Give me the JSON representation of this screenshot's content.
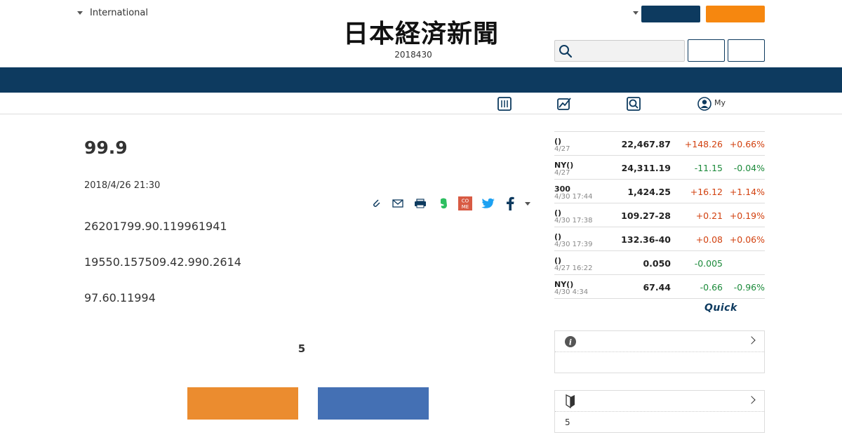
{
  "header": {
    "edition_label": "International",
    "logo_text": "日本経済新聞",
    "date_line": "2018430"
  },
  "subnav": {
    "my_label": "My"
  },
  "article": {
    "headline": "99.9",
    "pubdate": "2018/4/26 21:30",
    "paragraphs": [
      "26201799.90.119961941",
      "19550.157509.42.990.2614",
      "97.60.11994"
    ],
    "count_label": "5"
  },
  "market": {
    "rows": [
      {
        "name": "()",
        "date": "4/27",
        "value": "22,467.87",
        "change": "+148.26",
        "pct": "+0.66%",
        "dir": "up"
      },
      {
        "name": "NY()",
        "date": "4/27",
        "value": "24,311.19",
        "change": "-11.15",
        "pct": "-0.04%",
        "dir": "down"
      },
      {
        "name": "300",
        "date": "4/30 17:44",
        "value": "1,424.25",
        "change": "+16.12",
        "pct": "+1.14%",
        "dir": "up"
      },
      {
        "name": "()",
        "date": "4/30 17:38",
        "value": "109.27-28",
        "change": "+0.21",
        "pct": "+0.19%",
        "dir": "up"
      },
      {
        "name": "()",
        "date": "4/30 17:39",
        "value": "132.36-40",
        "change": "+0.08",
        "pct": "+0.06%",
        "dir": "up"
      },
      {
        "name": "()",
        "date": "4/27 16:22",
        "value": "0.050",
        "change": "-0.005",
        "pct": "",
        "dir": "down"
      },
      {
        "name": "NY()",
        "date": "4/30 4:34",
        "value": "67.44",
        "change": "-0.66",
        "pct": "-0.96%",
        "dir": "down"
      }
    ],
    "provider": "Quick"
  },
  "sidebar": {
    "beginner_count": "5"
  },
  "colors": {
    "navy": "#0d3a5f",
    "orange": "#f6870f",
    "up": "#d2410f",
    "down": "#1b8a3a"
  }
}
